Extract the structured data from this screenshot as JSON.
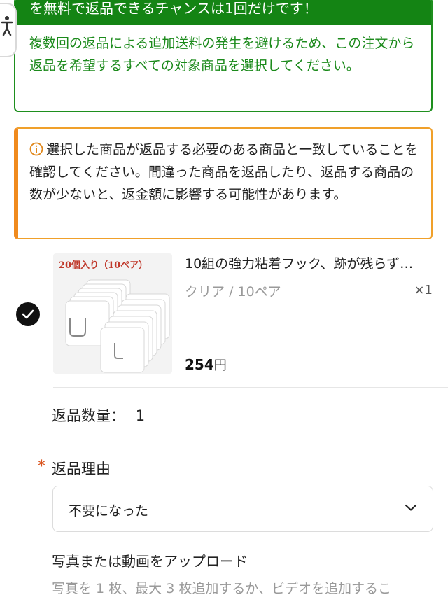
{
  "notice": {
    "banner_text": "を無料で返品できるチャンスは1回だけです！",
    "body_text": "複数回の返品による追加送料の発生を避けるため、この注文から返品を希望するすべての対象商品を選択してください。"
  },
  "warning": {
    "icon": "info-circle-icon",
    "text": "選択した商品が返品する必要のある商品と一致していることを確認してください。間違った商品を返品したり、返品する商品の数が少ないと、返金額に影響する可能性があります。"
  },
  "product": {
    "selected": true,
    "image_label": "20個入り（10ペア）",
    "title": "10組の強力粘着フック、跡が残らず…",
    "variant": "クリア / 10ペア",
    "quantity": "×1",
    "price_value": "254",
    "price_unit": "円"
  },
  "return_quantity": {
    "label": "返品数量：",
    "value": "1"
  },
  "return_reason": {
    "required_mark": "*",
    "label": "返品理由",
    "selected": "不要になった"
  },
  "upload": {
    "title": "写真または動画をアップロード",
    "help": "写真を 1 枚、最大 3 枚追加するか、ビデオを追加するこ"
  },
  "colors": {
    "success_green": "#148414",
    "warning_orange": "#f08a1d",
    "required_red": "#d9541e"
  }
}
